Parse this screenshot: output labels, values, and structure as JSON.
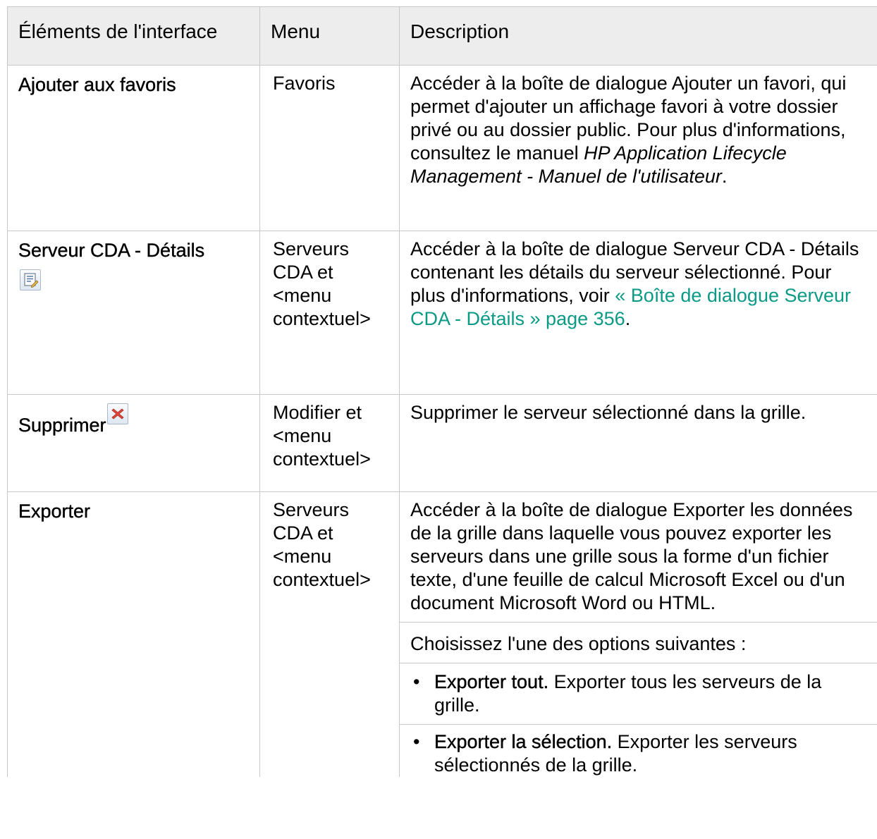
{
  "table": {
    "headers": [
      "Éléments de l'interface",
      "Menu",
      "Description"
    ],
    "rows": [
      {
        "element": "Ajouter aux favoris",
        "menu": "Favoris",
        "description": {
          "text": "Accéder à la boîte de dialogue Ajouter un favori, qui permet d'ajouter un affichage favori à votre dossier privé ou au dossier public. Pour plus d'informations, consultez le manuel ",
          "italic": "HP Application Lifecycle Management - Manuel de l'utilisateur",
          "after": "."
        }
      },
      {
        "element": "Serveur CDA - Détails",
        "icon": "details-icon",
        "menu": "Serveurs CDA et <menu contextuel>",
        "description": {
          "text": "Accéder à la boîte de dialogue Serveur CDA - Détails contenant les détails du serveur sélectionné. Pour plus d'informations, voir ",
          "link": "« Boîte de dialogue Serveur CDA - Détails » page 356",
          "after": "."
        }
      },
      {
        "element": "Supprimer",
        "icon": "delete-icon",
        "menu": "Modifier et <menu contextuel>",
        "description": {
          "text": "Supprimer le serveur sélectionné dans la grille."
        }
      },
      {
        "element": "Exporter",
        "menu": "Serveurs CDA et <menu contextuel>",
        "description": {
          "text": "Accéder à la boîte de dialogue Exporter les données de la grille dans laquelle vous pouvez exporter les serveurs dans une grille sous la forme d'un fichier texte, d'une feuille de calcul Microsoft Excel ou d'un document Microsoft Word ou HTML.",
          "intro": "Choisissez l'une des options suivantes :",
          "options": [
            {
              "label": "Exporter tout.",
              "text": " Exporter tous les serveurs de la grille."
            },
            {
              "label": "Exporter la sélection.",
              "text": " Exporter les serveurs sélectionnés de la grille."
            }
          ]
        }
      }
    ]
  },
  "colors": {
    "link": "#0b9a86",
    "header_bg": "#ededed",
    "border": "#c8c8c8"
  },
  "icons": {
    "details-icon": "document-edit-icon",
    "delete-icon": "red-x-icon",
    "bullet": "•"
  }
}
